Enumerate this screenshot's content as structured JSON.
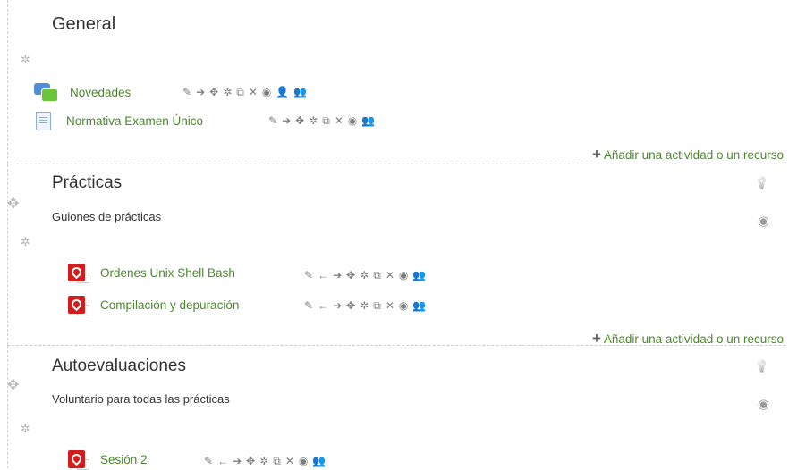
{
  "sections": [
    {
      "title": "General",
      "summary": "",
      "activities": [
        {
          "name": "Novedades",
          "icon": "forum-icon",
          "tools": [
            "✎",
            "➔",
            "✥",
            "✲",
            "⧉",
            "✕",
            "◉",
            "👤",
            "👥"
          ]
        },
        {
          "name": "Normativa Examen Único",
          "icon": "page-icon",
          "tools": [
            "✎",
            "➔",
            "✥",
            "✲",
            "⧉",
            "✕",
            "◉",
            "👥"
          ]
        }
      ],
      "add_label": "Añadir una actividad o un recurso"
    },
    {
      "title": "Prácticas",
      "summary": "Guiones de prácticas",
      "activities": [
        {
          "name": "Ordenes Unix Shell Bash",
          "icon": "pdf-icon",
          "tools": [
            "✎",
            "←",
            "➔",
            "✥",
            "✲",
            "⧉",
            "✕",
            "◉",
            "👥"
          ]
        },
        {
          "name": "Compilación y depuración",
          "icon": "pdf-icon",
          "tools": [
            "✎",
            "←",
            "➔",
            "✥",
            "✲",
            "⧉",
            "✕",
            "◉",
            "👥"
          ]
        }
      ],
      "add_label": "Añadir una actividad o un recurso"
    },
    {
      "title": "Autoevaluaciones",
      "summary": "Voluntario para todas las prácticas",
      "activities": [
        {
          "name": "Sesión 2",
          "icon": "pdf-icon",
          "tools": [
            "✎",
            "←",
            "➔",
            "✥",
            "✲",
            "⧉",
            "✕",
            "◉",
            "👥"
          ]
        }
      ]
    }
  ],
  "glyphs": {
    "gear": "✲",
    "move": "✥",
    "bulb": "💡",
    "eye": "◉",
    "plus": "+"
  },
  "colors": {
    "link_green": "#4a8a2b",
    "icon_grey": "#7d7d7d"
  }
}
